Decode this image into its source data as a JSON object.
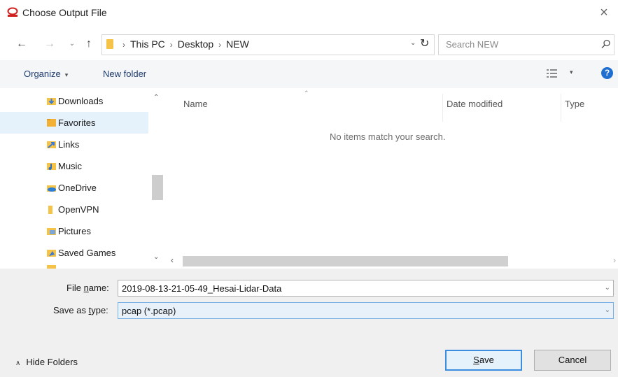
{
  "window": {
    "title": "Choose Output File",
    "close_glyph": "×",
    "accent_color": "#1f6fd1"
  },
  "nav": {
    "back_glyph": "←",
    "forward_glyph": "→",
    "recent_glyph": "⌄",
    "up_glyph": "↑",
    "address": {
      "crumbs": [
        "This PC",
        "Desktop",
        "NEW"
      ],
      "separator": "›",
      "dropdown_glyph": "⌄",
      "refresh_glyph": "↻"
    },
    "search": {
      "placeholder": "Search NEW"
    }
  },
  "toolbar": {
    "organize_label": "Organize",
    "organize_caret": "▾",
    "new_folder_label": "New folder",
    "view_dd_glyph": "▾",
    "help_label": "?"
  },
  "sidebar": {
    "items": [
      {
        "label": "Downloads",
        "icon": "downloads-folder-icon",
        "color": "#3b7ad9",
        "selected": false
      },
      {
        "label": "Favorites",
        "icon": "favorites-folder-icon",
        "color": "#f2b134",
        "selected": true
      },
      {
        "label": "Links",
        "icon": "links-folder-icon",
        "color": "#3b7ad9",
        "selected": false
      },
      {
        "label": "Music",
        "icon": "music-folder-icon",
        "color": "#f2a134",
        "selected": false
      },
      {
        "label": "OneDrive",
        "icon": "onedrive-icon",
        "color": "#2d7fd6",
        "selected": false
      },
      {
        "label": "OpenVPN",
        "icon": "openvpn-folder-icon",
        "color": "#f4c347",
        "selected": false
      },
      {
        "label": "Pictures",
        "icon": "pictures-folder-icon",
        "color": "#7aa6d8",
        "selected": false
      },
      {
        "label": "Saved Games",
        "icon": "saved-games-folder-icon",
        "color": "#3b7ad9",
        "selected": false
      }
    ],
    "scroll_up_glyph": "⌃",
    "scroll_down_glyph": "⌄"
  },
  "filelist": {
    "sort_glyph": "⌃",
    "columns": [
      "Name",
      "Date modified",
      "Type"
    ],
    "empty_message": "No items match your search.",
    "scroll_left_glyph": "‹",
    "scroll_right_glyph": "›"
  },
  "form": {
    "filename_label_pre": "File ",
    "filename_label_ul": "n",
    "filename_label_post": "ame:",
    "filename_value": "2019-08-13-21-05-49_Hesai-Lidar-Data",
    "savetype_label_pre": "Save as ",
    "savetype_label_ul": "t",
    "savetype_label_post": "ype:",
    "savetype_value": "pcap (*.pcap)",
    "dropdown_glyph": "⌄"
  },
  "footer": {
    "hide_folders_chev": "∧",
    "hide_folders_label": "Hide Folders",
    "save_label_ul": "S",
    "save_label_rest": "ave",
    "cancel_label": "Cancel"
  }
}
